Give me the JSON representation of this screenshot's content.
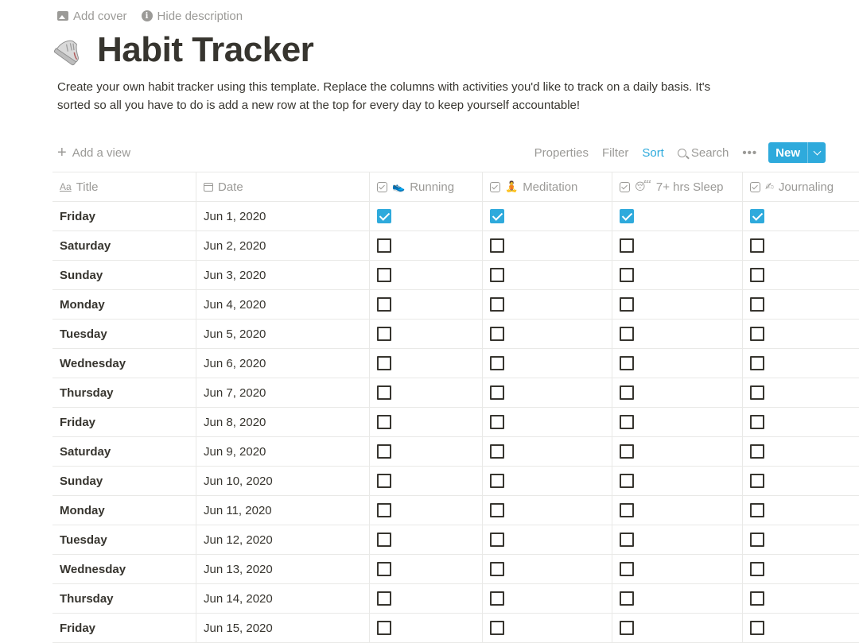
{
  "page_actions": {
    "add_cover": "Add cover",
    "hide_description": "Hide description"
  },
  "page": {
    "icon": "running-shoe-icon",
    "title": "Habit Tracker",
    "description": "Create your own habit tracker using this template. Replace the columns with activities you'd like to track on a daily basis. It's sorted so all you have to do is add a new row at the top for every day to keep yourself accountable!"
  },
  "toolbar": {
    "add_view": "Add a view",
    "properties": "Properties",
    "filter": "Filter",
    "sort": "Sort",
    "search": "Search",
    "more": "•••",
    "new": "New"
  },
  "colors": {
    "accent": "#2eaadc",
    "text": "#37352f",
    "muted": "#9b9a97",
    "border": "#e9e9e7"
  },
  "columns": [
    {
      "label": "Title",
      "type": "title",
      "icon": "Aa"
    },
    {
      "label": "Date",
      "type": "date",
      "icon": "calendar-icon"
    },
    {
      "label": "Running",
      "type": "checkbox",
      "icon": "checkbox-property-icon",
      "emoji": "👟"
    },
    {
      "label": "Meditation",
      "type": "checkbox",
      "icon": "checkbox-property-icon",
      "emoji": "🧘"
    },
    {
      "label": "7+ hrs Sleep",
      "type": "checkbox",
      "icon": "checkbox-property-icon",
      "emoji": "😴"
    },
    {
      "label": "Journaling",
      "type": "checkbox",
      "icon": "checkbox-property-icon",
      "emoji": "✍"
    }
  ],
  "rows": [
    {
      "title": "Friday",
      "date": "Jun 1, 2020",
      "running": true,
      "meditation": true,
      "sleep": true,
      "journaling": true
    },
    {
      "title": "Saturday",
      "date": "Jun 2, 2020",
      "running": false,
      "meditation": false,
      "sleep": false,
      "journaling": false
    },
    {
      "title": "Sunday",
      "date": "Jun 3, 2020",
      "running": false,
      "meditation": false,
      "sleep": false,
      "journaling": false
    },
    {
      "title": "Monday",
      "date": "Jun 4, 2020",
      "running": false,
      "meditation": false,
      "sleep": false,
      "journaling": false
    },
    {
      "title": "Tuesday",
      "date": "Jun 5, 2020",
      "running": false,
      "meditation": false,
      "sleep": false,
      "journaling": false
    },
    {
      "title": "Wednesday",
      "date": "Jun 6, 2020",
      "running": false,
      "meditation": false,
      "sleep": false,
      "journaling": false
    },
    {
      "title": "Thursday",
      "date": "Jun 7, 2020",
      "running": false,
      "meditation": false,
      "sleep": false,
      "journaling": false
    },
    {
      "title": "Friday",
      "date": "Jun 8, 2020",
      "running": false,
      "meditation": false,
      "sleep": false,
      "journaling": false
    },
    {
      "title": "Saturday",
      "date": "Jun 9, 2020",
      "running": false,
      "meditation": false,
      "sleep": false,
      "journaling": false
    },
    {
      "title": "Sunday",
      "date": "Jun 10, 2020",
      "running": false,
      "meditation": false,
      "sleep": false,
      "journaling": false
    },
    {
      "title": "Monday",
      "date": "Jun 11, 2020",
      "running": false,
      "meditation": false,
      "sleep": false,
      "journaling": false
    },
    {
      "title": "Tuesday",
      "date": "Jun 12, 2020",
      "running": false,
      "meditation": false,
      "sleep": false,
      "journaling": false
    },
    {
      "title": "Wednesday",
      "date": "Jun 13, 2020",
      "running": false,
      "meditation": false,
      "sleep": false,
      "journaling": false
    },
    {
      "title": "Thursday",
      "date": "Jun 14, 2020",
      "running": false,
      "meditation": false,
      "sleep": false,
      "journaling": false
    },
    {
      "title": "Friday",
      "date": "Jun 15, 2020",
      "running": false,
      "meditation": false,
      "sleep": false,
      "journaling": false
    }
  ]
}
